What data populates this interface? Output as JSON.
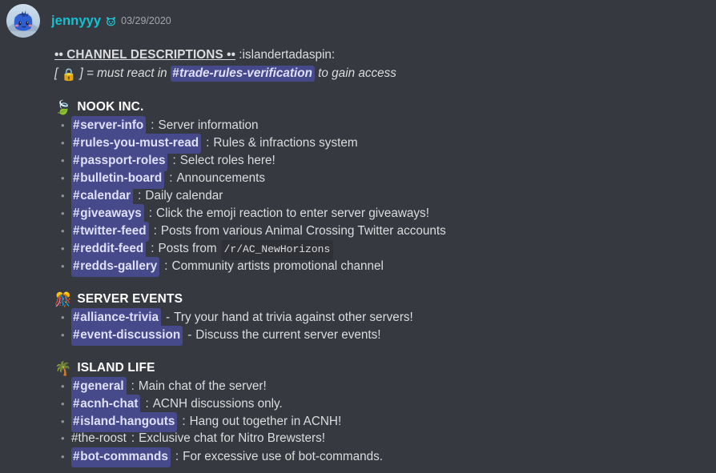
{
  "message": {
    "author": "jennyyy",
    "author_badge_icon": "animal-face-emoji",
    "timestamp": "03/29/2020",
    "avatar_alt": "jennyyy-avatar"
  },
  "body": {
    "title": "•• CHANNEL DESCRIPTIONS ••",
    "title_suffix": ":islandertadaspin:",
    "legend": {
      "open_bracket": "[",
      "lock_icon": "🔒",
      "close_bracket": "]",
      "equals_text": "= must react in",
      "channel_hash": "#",
      "channel_name": "trade-rules-verification",
      "tail_text": "to gain access"
    }
  },
  "sections": [
    {
      "emoji": "🍃",
      "emoji_name": "leaf-icon",
      "title": "NOOK INC.",
      "items": [
        {
          "bullet": "•",
          "hash": "#",
          "channel": "server-info",
          "is_mention": true,
          "sep": ":",
          "desc": "Server information"
        },
        {
          "bullet": "•",
          "hash": "#",
          "channel": "rules-you-must-read",
          "is_mention": true,
          "sep": ":",
          "desc": "Rules & infractions system"
        },
        {
          "bullet": "•",
          "hash": "#",
          "channel": "passport-roles",
          "is_mention": true,
          "sep": ":",
          "desc": "Select roles here!"
        },
        {
          "bullet": "•",
          "hash": "#",
          "channel": "bulletin-board",
          "is_mention": true,
          "sep": ":",
          "desc": "Announcements"
        },
        {
          "bullet": "•",
          "hash": "#",
          "channel": "calendar",
          "is_mention": true,
          "sep": ":",
          "desc": "Daily calendar"
        },
        {
          "bullet": "•",
          "hash": "#",
          "channel": "giveaways",
          "is_mention": true,
          "sep": ":",
          "desc": "Click the emoji reaction to enter server giveaways!"
        },
        {
          "bullet": "•",
          "hash": "#",
          "channel": "twitter-feed",
          "is_mention": true,
          "sep": ":",
          "desc": "Posts from various Animal Crossing Twitter accounts"
        },
        {
          "bullet": "•",
          "hash": "#",
          "channel": "reddit-feed",
          "is_mention": true,
          "sep": ":",
          "desc": "Posts from",
          "code": "/r/AC_NewHorizons"
        },
        {
          "bullet": "•",
          "hash": "#",
          "channel": "redds-gallery",
          "is_mention": true,
          "sep": ":",
          "desc": "Community artists promotional channel"
        }
      ]
    },
    {
      "emoji": "🎊",
      "emoji_name": "confetti-ball-icon",
      "title": "SERVER EVENTS",
      "items": [
        {
          "bullet": "•",
          "hash": "#",
          "channel": "alliance-trivia",
          "is_mention": true,
          "sep": "-",
          "desc": "Try your hand at trivia against other servers!"
        },
        {
          "bullet": "•",
          "hash": "#",
          "channel": "event-discussion",
          "is_mention": true,
          "sep": "-",
          "desc": "Discuss the current server events!"
        }
      ]
    },
    {
      "emoji": "🌴",
      "emoji_name": "palm-tree-icon",
      "title": "ISLAND LIFE",
      "items": [
        {
          "bullet": "•",
          "hash": "#",
          "channel": "general",
          "is_mention": true,
          "sep": ":",
          "desc": "Main chat of the server!"
        },
        {
          "bullet": "•",
          "hash": "#",
          "channel": "acnh-chat",
          "is_mention": true,
          "sep": ":",
          "desc": "ACNH discussions only."
        },
        {
          "bullet": "•",
          "hash": "#",
          "channel": "island-hangouts",
          "is_mention": true,
          "sep": ":",
          "desc": "Hang out together in ACNH!"
        },
        {
          "bullet": "•",
          "hash": "#",
          "channel": "the-roost",
          "is_mention": false,
          "sep": ":",
          "desc": "Exclusive chat for Nitro Brewsters!"
        },
        {
          "bullet": "•",
          "hash": "#",
          "channel": "bot-commands",
          "is_mention": true,
          "sep": ":",
          "desc": "For excessive use of bot-commands."
        }
      ]
    }
  ],
  "colors": {
    "background": "#36393f",
    "username": "#12c2d4",
    "mention_bg": "#46498a",
    "mention_text": "#dee0fc",
    "body_text": "#dcddde",
    "muted_text": "#a3a6aa",
    "code_bg": "#2f3136"
  }
}
